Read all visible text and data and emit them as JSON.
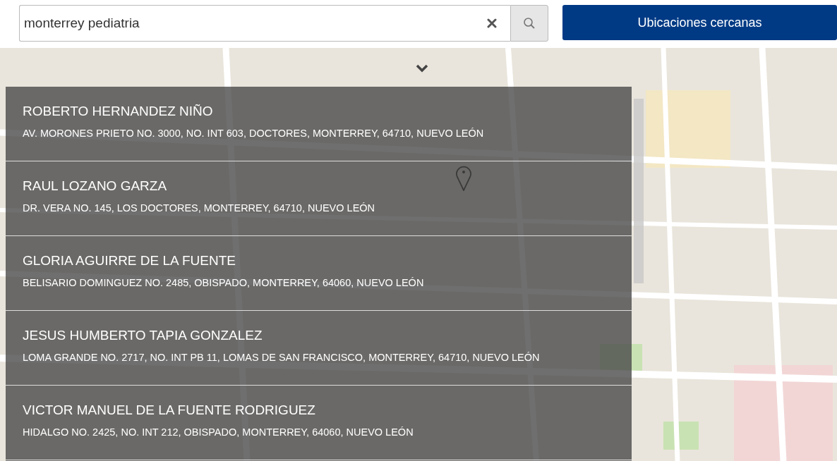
{
  "search": {
    "value": "monterrey pediatria"
  },
  "nearby_button": "Ubicaciones cercanas",
  "results": [
    {
      "name": "ROBERTO HERNANDEZ NIÑO",
      "address": "AV. MORONES PRIETO NO. 3000, NO. INT 603, DOCTORES, MONTERREY, 64710, NUEVO LEÓN"
    },
    {
      "name": "RAUL LOZANO GARZA",
      "address": "DR. VERA NO. 145, LOS DOCTORES, MONTERREY, 64710, NUEVO LEÓN"
    },
    {
      "name": "GLORIA AGUIRRE DE LA FUENTE",
      "address": "BELISARIO DOMINGUEZ NO. 2485, OBISPADO, MONTERREY, 64060, NUEVO LEÓN"
    },
    {
      "name": "JESUS HUMBERTO TAPIA GONZALEZ",
      "address": "LOMA GRANDE NO. 2717, NO. INT PB 11, LOMAS DE SAN FRANCISCO, MONTERREY, 64710, NUEVO LEÓN"
    },
    {
      "name": "VICTOR MANUEL DE LA FUENTE RODRIGUEZ",
      "address": "HIDALGO NO. 2425, NO. INT 212, OBISPADO, MONTERREY, 64060, NUEVO LEÓN"
    }
  ]
}
